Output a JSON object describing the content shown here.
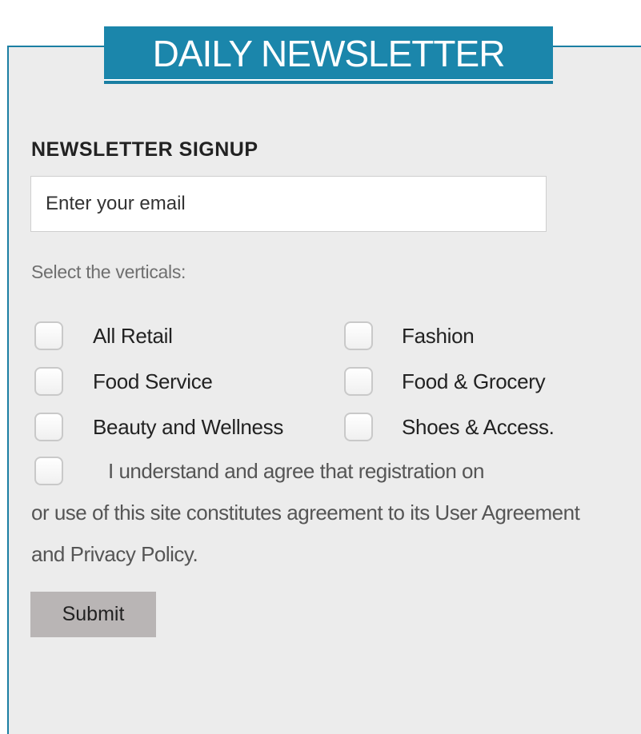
{
  "banner": {
    "title": "DAILY NEWSLETTER"
  },
  "signup": {
    "heading": "NEWSLETTER SIGNUP",
    "email_placeholder": "Enter your email",
    "verticals_label": "Select the verticals:",
    "verticals": [
      {
        "label": "All Retail",
        "checked": false
      },
      {
        "label": "Fashion",
        "checked": false
      },
      {
        "label": "Food Service",
        "checked": false
      },
      {
        "label": "Food & Grocery",
        "checked": false
      },
      {
        "label": "Beauty and Wellness",
        "checked": false
      },
      {
        "label": "Shoes & Access.",
        "checked": false
      }
    ],
    "agreement": {
      "line1": "I understand and agree that registration on",
      "rest": "or use of this site constitutes agreement to its User Agreement and Privacy Policy.",
      "checked": false
    },
    "submit_label": "Submit"
  },
  "colors": {
    "accent": "#1b86ab",
    "panel_background": "#ececec",
    "button_background": "#b9b5b5"
  }
}
